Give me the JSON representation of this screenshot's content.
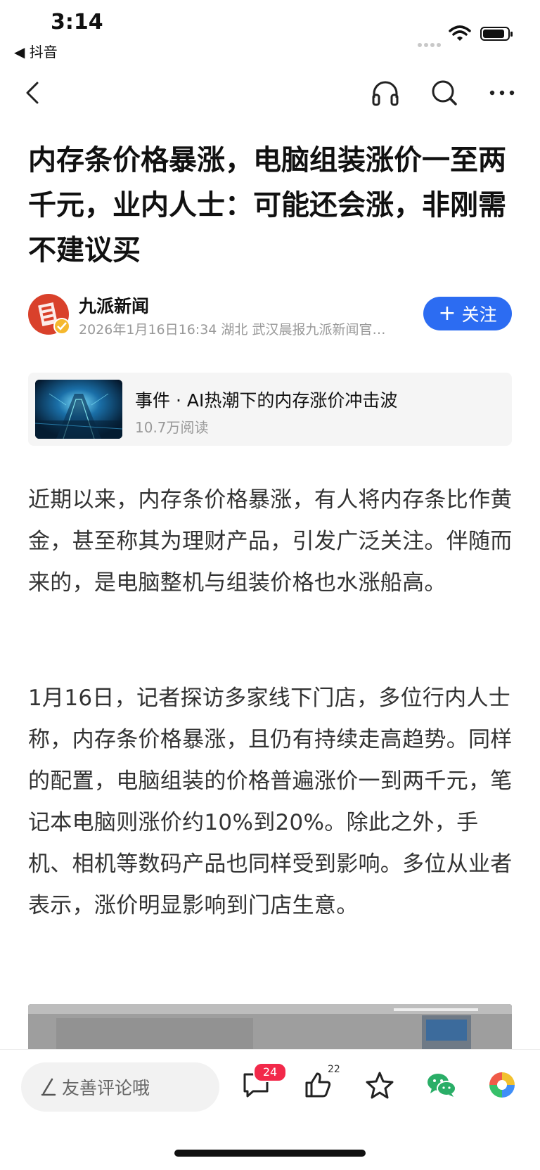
{
  "status_bar": {
    "time": "3:14",
    "back_app": "◀ 抖音"
  },
  "article": {
    "title": "内存条价格暴涨，电脑组装涨价一至两千元，业内人士：可能还会涨，非刚需不建议买",
    "author": {
      "name": "九派新闻",
      "meta": "2026年1月16日16:34 湖北 武汉晨报九派新闻官…",
      "follow_label": "关注",
      "follow_plus": "+"
    },
    "event": {
      "title": "事件 · AI热潮下的内存涨价冲击波",
      "reads": "10.7万阅读"
    },
    "paragraphs": [
      "近期以来，内存条价格暴涨，有人将内存条比作黄金，甚至称其为理财产品，引发广泛关注。伴随而来的，是电脑整机与组装价格也水涨船高。",
      "1月16日，记者探访多家线下门店，多位行内人士称，内存条价格暴涨，且仍有持续走高趋势。同样的配置，电脑组装的价格普遍涨价一到两千元，笔记本电脑则涨价约10%到20%。除此之外，手机、相机等数码产品也同样受到影响。多位从业者表示，涨价明显影响到门店生意。"
    ]
  },
  "bottom_bar": {
    "comment_placeholder": "友善评论哦",
    "comment_count": "24",
    "like_count": "22"
  },
  "colors": {
    "accent": "#2c6cf2",
    "badge": "#f2294a",
    "avatar": "#d9412b"
  },
  "icons": [
    "back-icon",
    "headphones-icon",
    "search-icon",
    "more-icon",
    "comment-icon",
    "like-icon",
    "star-icon",
    "wechat-icon",
    "share-icon"
  ]
}
